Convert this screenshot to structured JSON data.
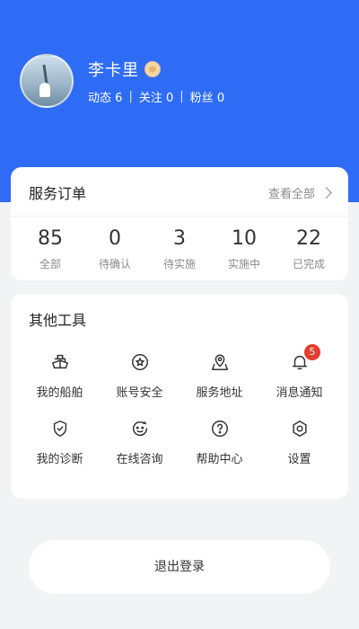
{
  "profile": {
    "name": "李卡里",
    "stats": [
      {
        "label": "动态",
        "value": "6"
      },
      {
        "label": "关注",
        "value": "0"
      },
      {
        "label": "粉丝",
        "value": "0"
      }
    ]
  },
  "orders": {
    "title": "服务订单",
    "view_all": "查看全部",
    "items": [
      {
        "value": "85",
        "label": "全部"
      },
      {
        "value": "0",
        "label": "待确认"
      },
      {
        "value": "3",
        "label": "待实施"
      },
      {
        "value": "10",
        "label": "实施中"
      },
      {
        "value": "22",
        "label": "已完成"
      }
    ]
  },
  "tools": {
    "title": "其他工具",
    "items": [
      {
        "label": "我的船舶",
        "icon": "ship-icon"
      },
      {
        "label": "账号安全",
        "icon": "shield-star-icon"
      },
      {
        "label": "服务地址",
        "icon": "map-pin-icon"
      },
      {
        "label": "消息通知",
        "icon": "bell-icon",
        "badge": "5"
      },
      {
        "label": "我的诊断",
        "icon": "check-shield-icon"
      },
      {
        "label": "在线咨询",
        "icon": "chat-face-icon"
      },
      {
        "label": "帮助中心",
        "icon": "help-icon"
      },
      {
        "label": "设置",
        "icon": "settings-icon"
      }
    ]
  },
  "logout_label": "退出登录",
  "colors": {
    "header": "#2f6cf6",
    "badge": "#e23d2f"
  }
}
